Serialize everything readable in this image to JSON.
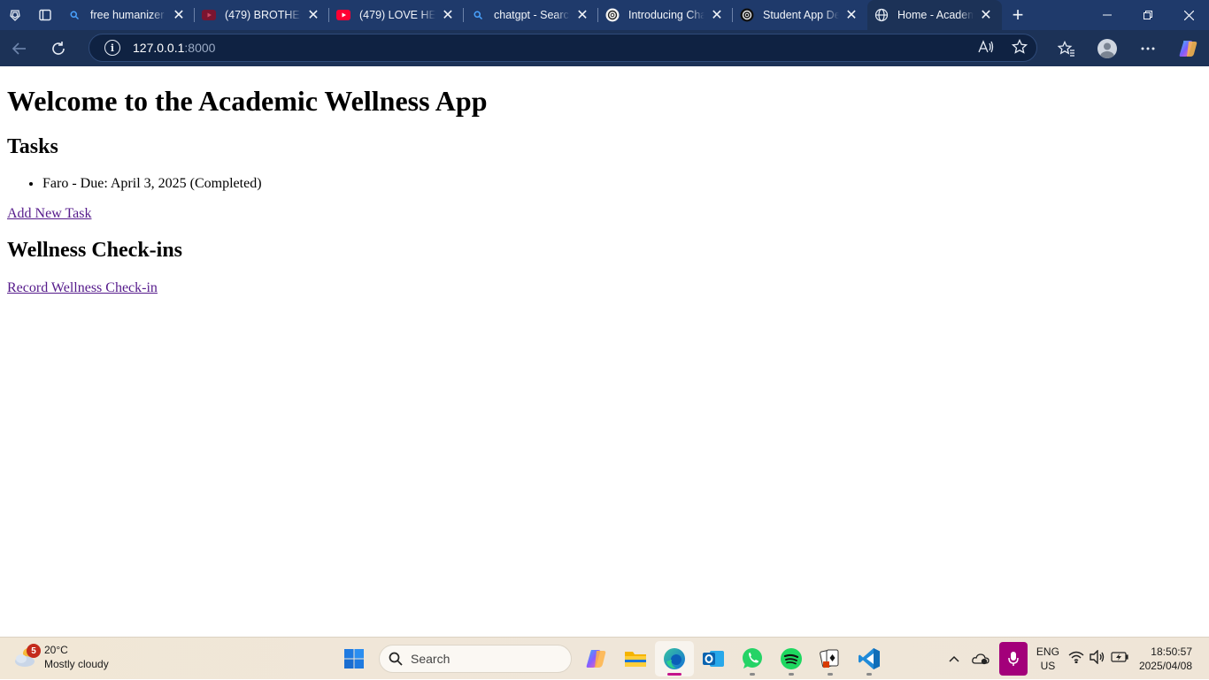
{
  "browser": {
    "tabs": [
      {
        "title": "free humanizer -",
        "favicon": "bing-search-icon"
      },
      {
        "title": "(479) BROTHER B",
        "favicon": "youtube-icon"
      },
      {
        "title": "(479) LOVE HEAL",
        "favicon": "youtube-icon"
      },
      {
        "title": "chatgpt - Search",
        "favicon": "bing-search-icon"
      },
      {
        "title": "Introducing Chat",
        "favicon": "openai-icon"
      },
      {
        "title": "Student App Des",
        "favicon": "openai-icon"
      },
      {
        "title": "Home - Academi",
        "favicon": "globe-icon",
        "active": true
      }
    ],
    "address": {
      "host": "127.0.0.1",
      "port": ":8000"
    }
  },
  "page": {
    "heading": "Welcome to the Academic Wellness App",
    "tasks_heading": "Tasks",
    "tasks": [
      {
        "text": "Faro - Due: April 3, 2025 (Completed)"
      }
    ],
    "add_task_link": "Add New Task",
    "wellness_heading": "Wellness Check-ins",
    "record_link": "Record Wellness Check-in"
  },
  "taskbar": {
    "weather": {
      "temp": "20°C",
      "condition": "Mostly cloudy",
      "badge": "5"
    },
    "search_placeholder": "Search",
    "language": {
      "lang": "ENG",
      "region": "US"
    },
    "clock": {
      "time": "18:50:57",
      "date": "2025/04/08"
    }
  },
  "colors": {
    "tabstrip": "#1f3a6b",
    "toolbar": "#1c3257",
    "visited_link": "#551a8b",
    "mic_accent": "#a3007a"
  }
}
